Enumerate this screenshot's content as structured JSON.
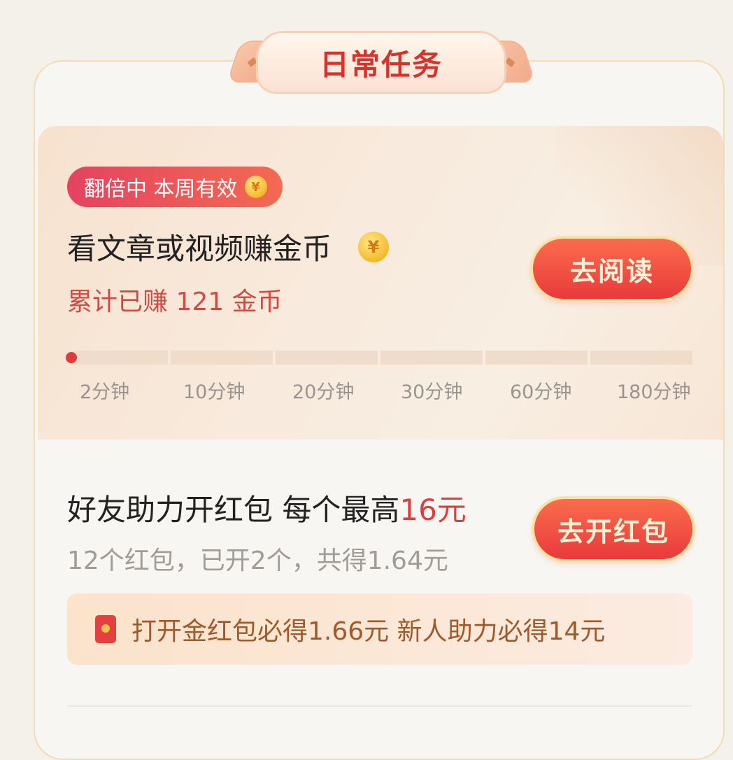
{
  "header": {
    "title": "日常任务"
  },
  "task_read": {
    "badge": "翻倍中 本周有效",
    "badge_icon": "coin-icon",
    "title": "看文章或视频赚金币",
    "earned": "累计已赚 121 金币",
    "button": "去阅读",
    "progress_fraction": 0.005,
    "milestones": [
      "2分钟",
      "10分钟",
      "20分钟",
      "30分钟",
      "60分钟",
      "180分钟"
    ]
  },
  "task_redpacket": {
    "title_prefix": "好友助力开红包 每个最高",
    "title_amount": "16元",
    "subtitle": "12个红包，已开2个，共得1.64元",
    "button": "去开红包",
    "notice": "打开金红包必得1.66元 新人助力必得14元",
    "notice_icon": "red-envelope-icon"
  },
  "colors": {
    "accent_red": "#e13d3d",
    "badge_gradient_start": "#e44360",
    "button_red": "#e93a3b",
    "progress_fill": "#e03c3c"
  }
}
